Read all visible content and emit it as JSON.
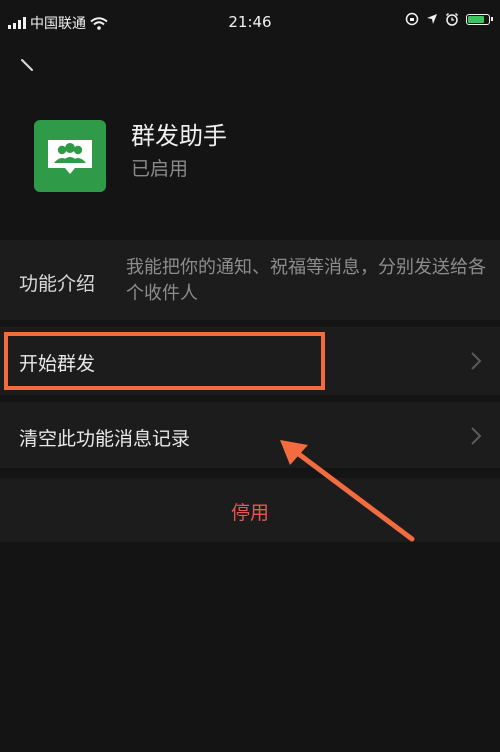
{
  "status_bar": {
    "carrier": "中国联通",
    "time": "21:46",
    "battery_level": 0.85
  },
  "icons": {
    "back": "back-arrow-icon",
    "app": "group-broadcast-icon",
    "chevron": "chevron-right-icon",
    "wifi": "wifi-icon",
    "signal": "signal-icon",
    "lock": "orientation-lock-icon",
    "location": "location-icon",
    "alarm": "alarm-icon",
    "battery": "battery-icon"
  },
  "app": {
    "title": "群发助手",
    "status": "已启用"
  },
  "intro": {
    "label": "功能介绍",
    "description": "我能把你的通知、祝福等消息，分别发送给各个收件人"
  },
  "actions": {
    "start_label": "开始群发",
    "clear_label": "清空此功能消息记录",
    "disable_label": "停用"
  },
  "colors": {
    "background": "#141414",
    "section": "#1c1c1c",
    "app_icon": "#2f9a47",
    "disable_text": "#e05a4e",
    "annotation": "#f36c3f"
  }
}
